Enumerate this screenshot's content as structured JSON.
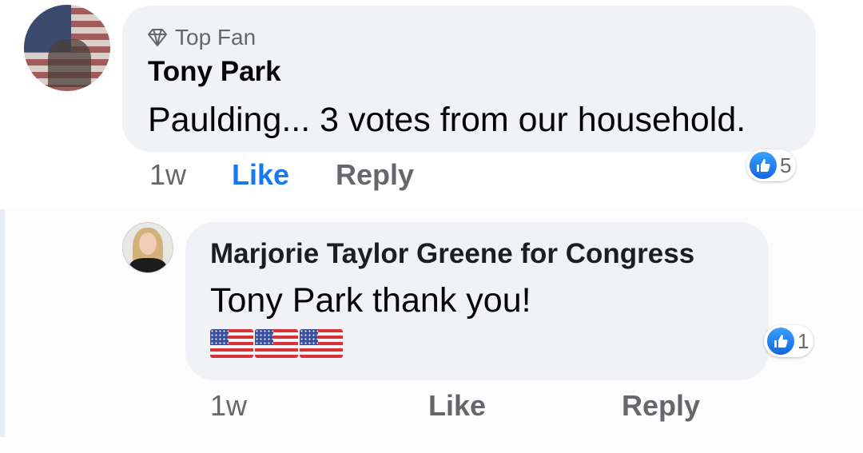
{
  "comment": {
    "badge_label": "Top Fan",
    "author": "Tony Park",
    "text": "Paulding... 3 votes from our household.",
    "time": "1w",
    "like_label": "Like",
    "reply_label": "Reply",
    "reaction_count": "5",
    "reaction_icon": "like-thumb-icon",
    "like_active_color": "#1877f2"
  },
  "reply": {
    "author": "Marjorie Taylor Greene for Congress",
    "text": "Tony Park thank you!",
    "emoji": [
      "🇺🇸",
      "🇺🇸",
      "🇺🇸"
    ],
    "time": "1w",
    "like_label": "Like",
    "reply_label": "Reply",
    "reaction_count": "1",
    "reaction_icon": "like-thumb-icon"
  }
}
